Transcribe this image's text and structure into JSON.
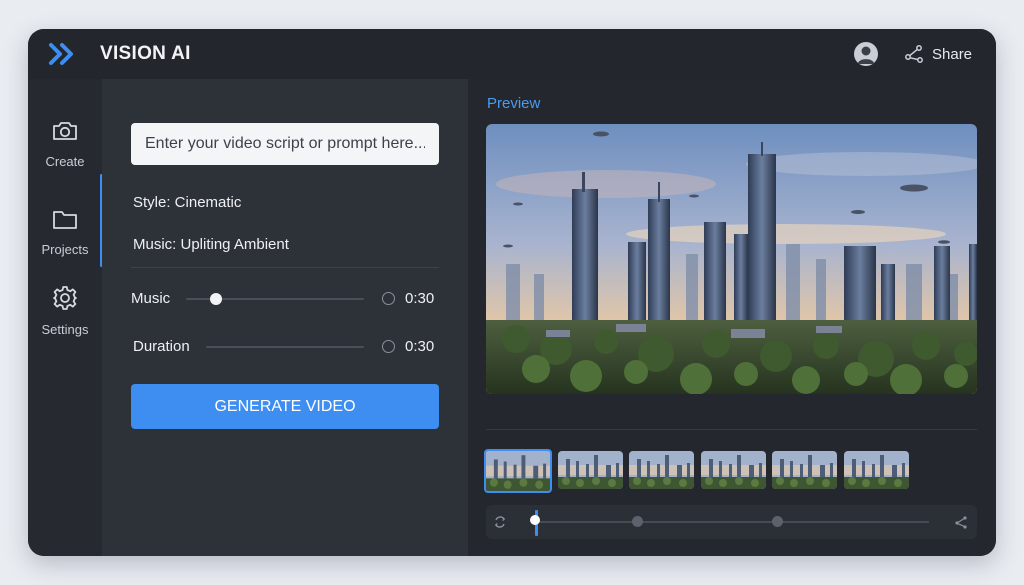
{
  "app": {
    "title": "VISION AI"
  },
  "header": {
    "share_label": "Share",
    "icons": [
      "user-avatar-icon",
      "share-icon"
    ]
  },
  "sidebar": {
    "items": [
      {
        "label": "Create",
        "icon": "camera-icon"
      },
      {
        "label": "Projects",
        "icon": "folder-icon",
        "active": true
      },
      {
        "label": "Settings",
        "icon": "gear-icon"
      }
    ]
  },
  "editor": {
    "prompt_placeholder": "Enter your video script or prompt here...",
    "style_text": "Style: Cinematic",
    "music_text": "Music: Upliting Ambient",
    "sliders": [
      {
        "label": "Music",
        "value": "0:30",
        "level": 0.17
      },
      {
        "label": "Duration",
        "value": "0:30",
        "level": 0.0
      }
    ],
    "generate_label": "GENERATE VIDEO"
  },
  "preview": {
    "title": "Preview",
    "thumbnail_count": 6,
    "selected_thumbnail": 1
  },
  "colors": {
    "accent": "#3d8ef0",
    "preview_title": "#4a9bf0",
    "window_bg": "#2b2f36"
  }
}
